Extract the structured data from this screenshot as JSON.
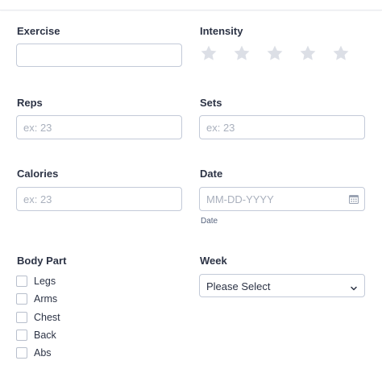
{
  "exercise": {
    "label": "Exercise",
    "value": "",
    "placeholder": ""
  },
  "intensity": {
    "label": "Intensity",
    "stars": 5,
    "rating": 0,
    "star_color": "#dcdfe6"
  },
  "reps": {
    "label": "Reps",
    "placeholder": "ex: 23"
  },
  "sets": {
    "label": "Sets",
    "placeholder": "ex: 23"
  },
  "calories": {
    "label": "Calories",
    "placeholder": "ex: 23"
  },
  "date": {
    "label": "Date",
    "placeholder": "MM-DD-YYYY",
    "sublabel": "Date",
    "icon": "calendar-icon"
  },
  "body_part": {
    "label": "Body Part",
    "options": [
      "Legs",
      "Arms",
      "Chest",
      "Back",
      "Abs"
    ]
  },
  "week": {
    "label": "Week",
    "selected": "Please Select",
    "icon": "chevron-down-icon"
  },
  "colors": {
    "border": "#c3cad8",
    "text": "#2c3345",
    "placeholder": "#a9b0bd"
  }
}
